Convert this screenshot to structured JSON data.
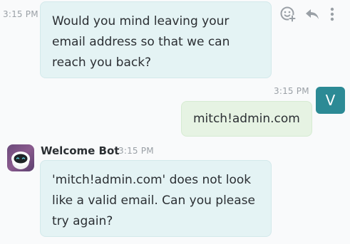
{
  "messages": [
    {
      "sender": "bot",
      "time": "3:15 PM",
      "text": "Would you mind leaving your email address so that we can reach you back?"
    },
    {
      "sender": "user",
      "time": "3:15 PM",
      "avatar_letter": "V",
      "text": "mitch!admin.com"
    },
    {
      "sender": "bot",
      "author": "Welcome Bot",
      "time": "3:15 PM",
      "text": "'mitch!admin.com' does not look like a valid email. Can you please try again?"
    }
  ],
  "message_actions": {
    "icons": [
      "add-reaction-icon",
      "reply-icon",
      "more-options-icon"
    ]
  },
  "colors": {
    "bot_bubble": "#e4f3f4",
    "user_bubble": "#e6f3e3",
    "user_avatar": "#2c8a95",
    "timestamp": "#9aa0a6"
  }
}
